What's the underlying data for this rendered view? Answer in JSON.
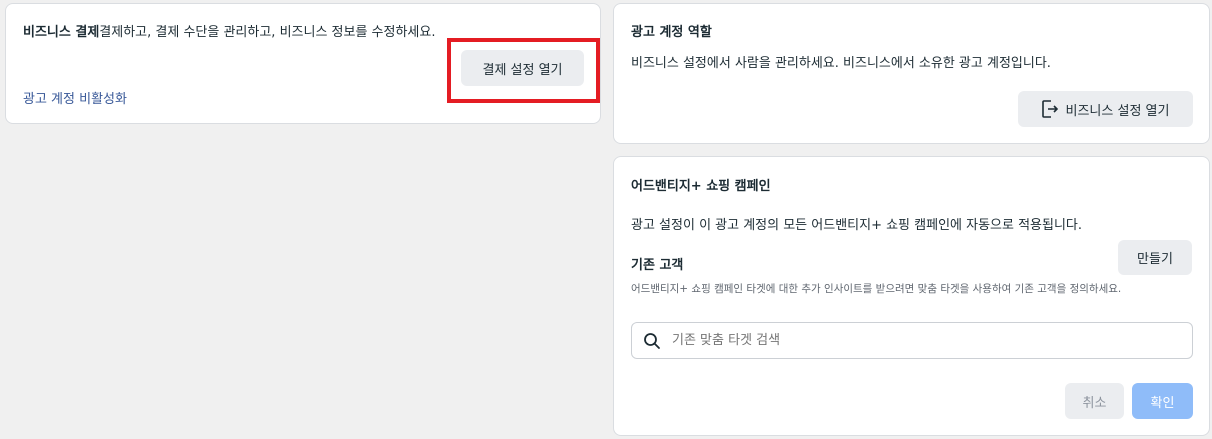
{
  "billing": {
    "title": "비즈니스 결제",
    "description": "결제하고, 결제 수단을 관리하고, 비즈니스 정보를 수정하세요.",
    "open_button": "결제 설정 열기",
    "deactivate_link": "광고 계정 비활성화",
    "highlight_color": "#e41c23"
  },
  "roles": {
    "title": "광고 계정 역할",
    "description": "비즈니스 설정에서 사람을 관리하세요. 비즈니스에서 소유한 광고 계정입니다.",
    "open_button": "비즈니스 설정 열기",
    "button_icon": "exit-icon"
  },
  "advantage": {
    "title": "어드밴티지+ 쇼핑 캠페인",
    "description": "광고 설정이 이 광고 계정의 모든 어드밴티지+ 쇼핑 캠페인에 자동으로 적용됩니다.",
    "existing_customers_title": "기존 고객",
    "create_button": "만들기",
    "helper_text": "어드밴티지+ 쇼핑 캠페인 타겟에 대한 추가 인사이트를 받으려면 맞춤 타겟을 사용하여 기존 고객을 정의하세요.",
    "search_placeholder": "기존 맞춤 타겟 검색",
    "search_icon": "search-icon",
    "cancel_button": "취소",
    "confirm_button": "확인",
    "confirm_color": "#8fbcf9"
  }
}
